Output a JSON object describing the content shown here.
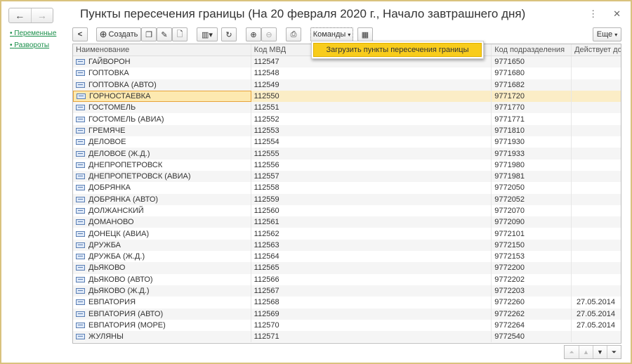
{
  "window": {
    "title": "Пункты пересечения границы (На 20 февраля 2020 г., Начало завтрашнего дня)",
    "more_icon": "⋮",
    "close_icon": "✕"
  },
  "nav": {
    "back": "←",
    "forward": "→"
  },
  "sidebar": {
    "items": [
      {
        "label": "Переменные"
      },
      {
        "label": "Развороты"
      }
    ]
  },
  "toolbar": {
    "back": "<",
    "create": "Создать",
    "commands": "Команды",
    "more": "Еще"
  },
  "menu": {
    "items": [
      {
        "label": "Загрузить пункты пересечения границы"
      }
    ]
  },
  "table": {
    "columns": [
      "Наименование",
      "Код МВД",
      "Код подразделения",
      "Действует до"
    ],
    "rows": [
      [
        "ГАЙВОРОН",
        "112547",
        "9771650",
        ""
      ],
      [
        "ГОПТОВКА",
        "112548",
        "9771680",
        ""
      ],
      [
        "ГОПТОВКА (АВТО)",
        "112549",
        "9771682",
        ""
      ],
      [
        "ГОРНОСТАЕВКА",
        "112550",
        "9771720",
        ""
      ],
      [
        "ГОСТОМЕЛЬ",
        "112551",
        "9771770",
        ""
      ],
      [
        "ГОСТОМЕЛЬ (АВИА)",
        "112552",
        "9771771",
        ""
      ],
      [
        "ГРЕМЯЧЕ",
        "112553",
        "9771810",
        ""
      ],
      [
        "ДЕЛОВОЕ",
        "112554",
        "9771930",
        ""
      ],
      [
        "ДЕЛОВОЕ (Ж.Д.)",
        "112555",
        "9771933",
        ""
      ],
      [
        "ДНЕПРОПЕТРОВСК",
        "112556",
        "9771980",
        ""
      ],
      [
        "ДНЕПРОПЕТРОВСК (АВИА)",
        "112557",
        "9771981",
        ""
      ],
      [
        "ДОБРЯНКА",
        "112558",
        "9772050",
        ""
      ],
      [
        "ДОБРЯНКА (АВТО)",
        "112559",
        "9772052",
        ""
      ],
      [
        "ДОЛЖАНСКИЙ",
        "112560",
        "9772070",
        ""
      ],
      [
        "ДОМАНОВО",
        "112561",
        "9772090",
        ""
      ],
      [
        "ДОНЕЦК (АВИА)",
        "112562",
        "9772101",
        ""
      ],
      [
        "ДРУЖБА",
        "112563",
        "9772150",
        ""
      ],
      [
        "ДРУЖБА (Ж.Д.)",
        "112564",
        "9772153",
        ""
      ],
      [
        "ДЬЯКОВО",
        "112565",
        "9772200",
        ""
      ],
      [
        "ДЬЯКОВО (АВТО)",
        "112566",
        "9772202",
        ""
      ],
      [
        "ДЬЯКОВО (Ж.Д.)",
        "112567",
        "9772203",
        ""
      ],
      [
        "ЕВПАТОРИЯ",
        "112568",
        "9772260",
        "27.05.2014"
      ],
      [
        "ЕВПАТОРИЯ (АВТО)",
        "112569",
        "9772262",
        "27.05.2014"
      ],
      [
        "ЕВПАТОРИЯ (МОРЕ)",
        "112570",
        "9772264",
        "27.05.2014"
      ],
      [
        "ЖУЛЯНЫ",
        "112571",
        "9772540",
        ""
      ]
    ],
    "selected_index": 3
  }
}
